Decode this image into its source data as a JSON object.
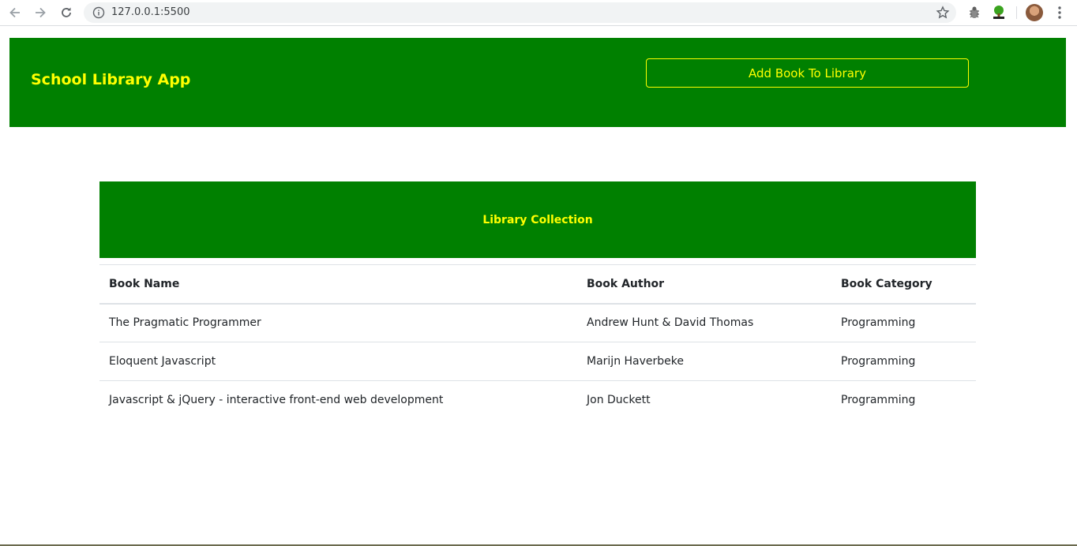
{
  "browser": {
    "url": "127.0.0.1:5500",
    "icons": [
      "back-arrow-icon",
      "forward-arrow-icon",
      "reload-icon",
      "info-icon",
      "star-icon",
      "bug-extension-icon",
      "tree-extension-icon",
      "avatar",
      "more-menu-icon"
    ]
  },
  "header": {
    "title": "School Library App",
    "add_button_label": "Add Book To Library",
    "colors": {
      "background": "#008000",
      "text": "#ffff00"
    }
  },
  "collection": {
    "title": "Library Collection",
    "columns": [
      "Book Name",
      "Book Author",
      "Book Category"
    ],
    "rows": [
      [
        "The Pragmatic Programmer",
        "Andrew Hunt & David Thomas",
        "Programming"
      ],
      [
        "Eloquent Javascript",
        "Marijn Haverbeke",
        "Programming"
      ],
      [
        "Javascript & jQuery - interactive front-end web development",
        "Jon Duckett",
        "Programming"
      ]
    ]
  }
}
